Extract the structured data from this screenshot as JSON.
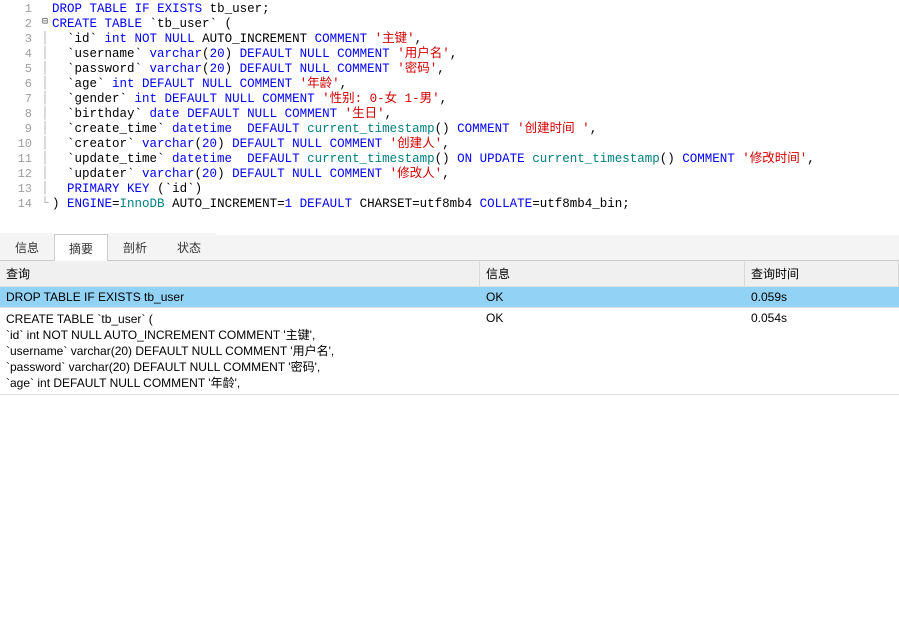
{
  "gutter": [
    "1",
    "2",
    "3",
    "4",
    "5",
    "6",
    "7",
    "8",
    "9",
    "10",
    "11",
    "12",
    "13",
    "14"
  ],
  "code_lines": [
    [
      {
        "cls": "kw",
        "t": "DROP"
      },
      {
        "cls": "black",
        "t": " "
      },
      {
        "cls": "kw",
        "t": "TABLE"
      },
      {
        "cls": "black",
        "t": " "
      },
      {
        "cls": "kw",
        "t": "IF"
      },
      {
        "cls": "black",
        "t": " "
      },
      {
        "cls": "kw",
        "t": "EXISTS"
      },
      {
        "cls": "black",
        "t": " tb_user;"
      }
    ],
    [
      {
        "cls": "kw",
        "t": "CREATE"
      },
      {
        "cls": "black",
        "t": " "
      },
      {
        "cls": "kw",
        "t": "TABLE"
      },
      {
        "cls": "black",
        "t": " `tb_user` ("
      }
    ],
    [
      {
        "cls": "black",
        "t": "  `id` "
      },
      {
        "cls": "dt",
        "t": "int"
      },
      {
        "cls": "black",
        "t": " "
      },
      {
        "cls": "kw",
        "t": "NOT"
      },
      {
        "cls": "black",
        "t": " "
      },
      {
        "cls": "kw",
        "t": "NULL"
      },
      {
        "cls": "black",
        "t": " AUTO_INCREMENT "
      },
      {
        "cls": "kw",
        "t": "COMMENT"
      },
      {
        "cls": "black",
        "t": " "
      },
      {
        "cls": "str",
        "t": "'主键'"
      },
      {
        "cls": "black",
        "t": ","
      }
    ],
    [
      {
        "cls": "black",
        "t": "  `username` "
      },
      {
        "cls": "dt",
        "t": "varchar"
      },
      {
        "cls": "black",
        "t": "("
      },
      {
        "cls": "num",
        "t": "20"
      },
      {
        "cls": "black",
        "t": ") "
      },
      {
        "cls": "kw",
        "t": "DEFAULT"
      },
      {
        "cls": "black",
        "t": " "
      },
      {
        "cls": "kw",
        "t": "NULL"
      },
      {
        "cls": "black",
        "t": " "
      },
      {
        "cls": "kw",
        "t": "COMMENT"
      },
      {
        "cls": "black",
        "t": " "
      },
      {
        "cls": "str",
        "t": "'用户名'"
      },
      {
        "cls": "black",
        "t": ","
      }
    ],
    [
      {
        "cls": "black",
        "t": "  `password` "
      },
      {
        "cls": "dt",
        "t": "varchar"
      },
      {
        "cls": "black",
        "t": "("
      },
      {
        "cls": "num",
        "t": "20"
      },
      {
        "cls": "black",
        "t": ") "
      },
      {
        "cls": "kw",
        "t": "DEFAULT"
      },
      {
        "cls": "black",
        "t": " "
      },
      {
        "cls": "kw",
        "t": "NULL"
      },
      {
        "cls": "black",
        "t": " "
      },
      {
        "cls": "kw",
        "t": "COMMENT"
      },
      {
        "cls": "black",
        "t": " "
      },
      {
        "cls": "str",
        "t": "'密码'"
      },
      {
        "cls": "black",
        "t": ","
      }
    ],
    [
      {
        "cls": "black",
        "t": "  `age` "
      },
      {
        "cls": "dt",
        "t": "int"
      },
      {
        "cls": "black",
        "t": " "
      },
      {
        "cls": "kw",
        "t": "DEFAULT"
      },
      {
        "cls": "black",
        "t": " "
      },
      {
        "cls": "kw",
        "t": "NULL"
      },
      {
        "cls": "black",
        "t": " "
      },
      {
        "cls": "kw",
        "t": "COMMENT"
      },
      {
        "cls": "black",
        "t": " "
      },
      {
        "cls": "str",
        "t": "'年龄'"
      },
      {
        "cls": "black",
        "t": ","
      }
    ],
    [
      {
        "cls": "black",
        "t": "  `gender` "
      },
      {
        "cls": "dt",
        "t": "int"
      },
      {
        "cls": "black",
        "t": " "
      },
      {
        "cls": "kw",
        "t": "DEFAULT"
      },
      {
        "cls": "black",
        "t": " "
      },
      {
        "cls": "kw",
        "t": "NULL"
      },
      {
        "cls": "black",
        "t": " "
      },
      {
        "cls": "kw",
        "t": "COMMENT"
      },
      {
        "cls": "black",
        "t": " "
      },
      {
        "cls": "str",
        "t": "'性别: 0-女 1-男'"
      },
      {
        "cls": "black",
        "t": ","
      }
    ],
    [
      {
        "cls": "black",
        "t": "  `birthday` "
      },
      {
        "cls": "dt",
        "t": "date"
      },
      {
        "cls": "black",
        "t": " "
      },
      {
        "cls": "kw",
        "t": "DEFAULT"
      },
      {
        "cls": "black",
        "t": " "
      },
      {
        "cls": "kw",
        "t": "NULL"
      },
      {
        "cls": "black",
        "t": " "
      },
      {
        "cls": "kw",
        "t": "COMMENT"
      },
      {
        "cls": "black",
        "t": " "
      },
      {
        "cls": "str",
        "t": "'生日'"
      },
      {
        "cls": "black",
        "t": ","
      }
    ],
    [
      {
        "cls": "black",
        "t": "  `create_time` "
      },
      {
        "cls": "dt",
        "t": "datetime"
      },
      {
        "cls": "black",
        "t": "  "
      },
      {
        "cls": "kw",
        "t": "DEFAULT"
      },
      {
        "cls": "black",
        "t": " "
      },
      {
        "cls": "func",
        "t": "current_timestamp"
      },
      {
        "cls": "black",
        "t": "() "
      },
      {
        "cls": "kw",
        "t": "COMMENT"
      },
      {
        "cls": "black",
        "t": " "
      },
      {
        "cls": "str",
        "t": "'创建时间 '"
      },
      {
        "cls": "black",
        "t": ","
      }
    ],
    [
      {
        "cls": "black",
        "t": "  `creator` "
      },
      {
        "cls": "dt",
        "t": "varchar"
      },
      {
        "cls": "black",
        "t": "("
      },
      {
        "cls": "num",
        "t": "20"
      },
      {
        "cls": "black",
        "t": ") "
      },
      {
        "cls": "kw",
        "t": "DEFAULT"
      },
      {
        "cls": "black",
        "t": " "
      },
      {
        "cls": "kw",
        "t": "NULL"
      },
      {
        "cls": "black",
        "t": " "
      },
      {
        "cls": "kw",
        "t": "COMMENT"
      },
      {
        "cls": "black",
        "t": " "
      },
      {
        "cls": "str",
        "t": "'创建人'"
      },
      {
        "cls": "black",
        "t": ","
      }
    ],
    [
      {
        "cls": "black",
        "t": "  `update_time` "
      },
      {
        "cls": "dt",
        "t": "datetime"
      },
      {
        "cls": "black",
        "t": "  "
      },
      {
        "cls": "kw",
        "t": "DEFAULT"
      },
      {
        "cls": "black",
        "t": " "
      },
      {
        "cls": "func",
        "t": "current_timestamp"
      },
      {
        "cls": "black",
        "t": "() "
      },
      {
        "cls": "kw",
        "t": "ON"
      },
      {
        "cls": "black",
        "t": " "
      },
      {
        "cls": "kw",
        "t": "UPDATE"
      },
      {
        "cls": "black",
        "t": " "
      },
      {
        "cls": "func",
        "t": "current_timestamp"
      },
      {
        "cls": "black",
        "t": "() "
      },
      {
        "cls": "kw",
        "t": "COMMENT"
      },
      {
        "cls": "black",
        "t": " "
      },
      {
        "cls": "str",
        "t": "'修改时间'"
      },
      {
        "cls": "black",
        "t": ","
      }
    ],
    [
      {
        "cls": "black",
        "t": "  `updater` "
      },
      {
        "cls": "dt",
        "t": "varchar"
      },
      {
        "cls": "black",
        "t": "("
      },
      {
        "cls": "num",
        "t": "20"
      },
      {
        "cls": "black",
        "t": ") "
      },
      {
        "cls": "kw",
        "t": "DEFAULT"
      },
      {
        "cls": "black",
        "t": " "
      },
      {
        "cls": "kw",
        "t": "NULL"
      },
      {
        "cls": "black",
        "t": " "
      },
      {
        "cls": "kw",
        "t": "COMMENT"
      },
      {
        "cls": "black",
        "t": " "
      },
      {
        "cls": "str",
        "t": "'修改人'"
      },
      {
        "cls": "black",
        "t": ","
      }
    ],
    [
      {
        "cls": "black",
        "t": "  "
      },
      {
        "cls": "kw",
        "t": "PRIMARY"
      },
      {
        "cls": "black",
        "t": " "
      },
      {
        "cls": "kw",
        "t": "KEY"
      },
      {
        "cls": "black",
        "t": " (`id`)"
      }
    ],
    [
      {
        "cls": "black",
        "t": ") "
      },
      {
        "cls": "kw",
        "t": "ENGINE"
      },
      {
        "cls": "black",
        "t": "="
      },
      {
        "cls": "eng",
        "t": "InnoDB"
      },
      {
        "cls": "black",
        "t": " AUTO_INCREMENT="
      },
      {
        "cls": "num",
        "t": "1"
      },
      {
        "cls": "black",
        "t": " "
      },
      {
        "cls": "kw",
        "t": "DEFAULT"
      },
      {
        "cls": "black",
        "t": " CHARSET=utf8mb4 "
      },
      {
        "cls": "kw",
        "t": "COLLATE"
      },
      {
        "cls": "black",
        "t": "=utf8mb4_bin;"
      }
    ]
  ],
  "tabs": {
    "t0": "信息",
    "t1": "摘要",
    "t2": "剖析",
    "t3": "状态"
  },
  "result_header": {
    "query": "查询",
    "info": "信息",
    "time": "查询时间"
  },
  "result_rows": [
    {
      "query": "DROP TABLE IF EXISTS tb_user",
      "info": "OK",
      "time": "0.059s",
      "selected": true
    },
    {
      "query": "CREATE TABLE `tb_user` (\n`id` int NOT NULL AUTO_INCREMENT COMMENT '主键',\n`username` varchar(20) DEFAULT NULL COMMENT '用户名',\n`password` varchar(20) DEFAULT NULL COMMENT '密码',\n`age` int DEFAULT NULL COMMENT '年龄',",
      "info": "OK",
      "time": "0.054s",
      "selected": false
    }
  ]
}
